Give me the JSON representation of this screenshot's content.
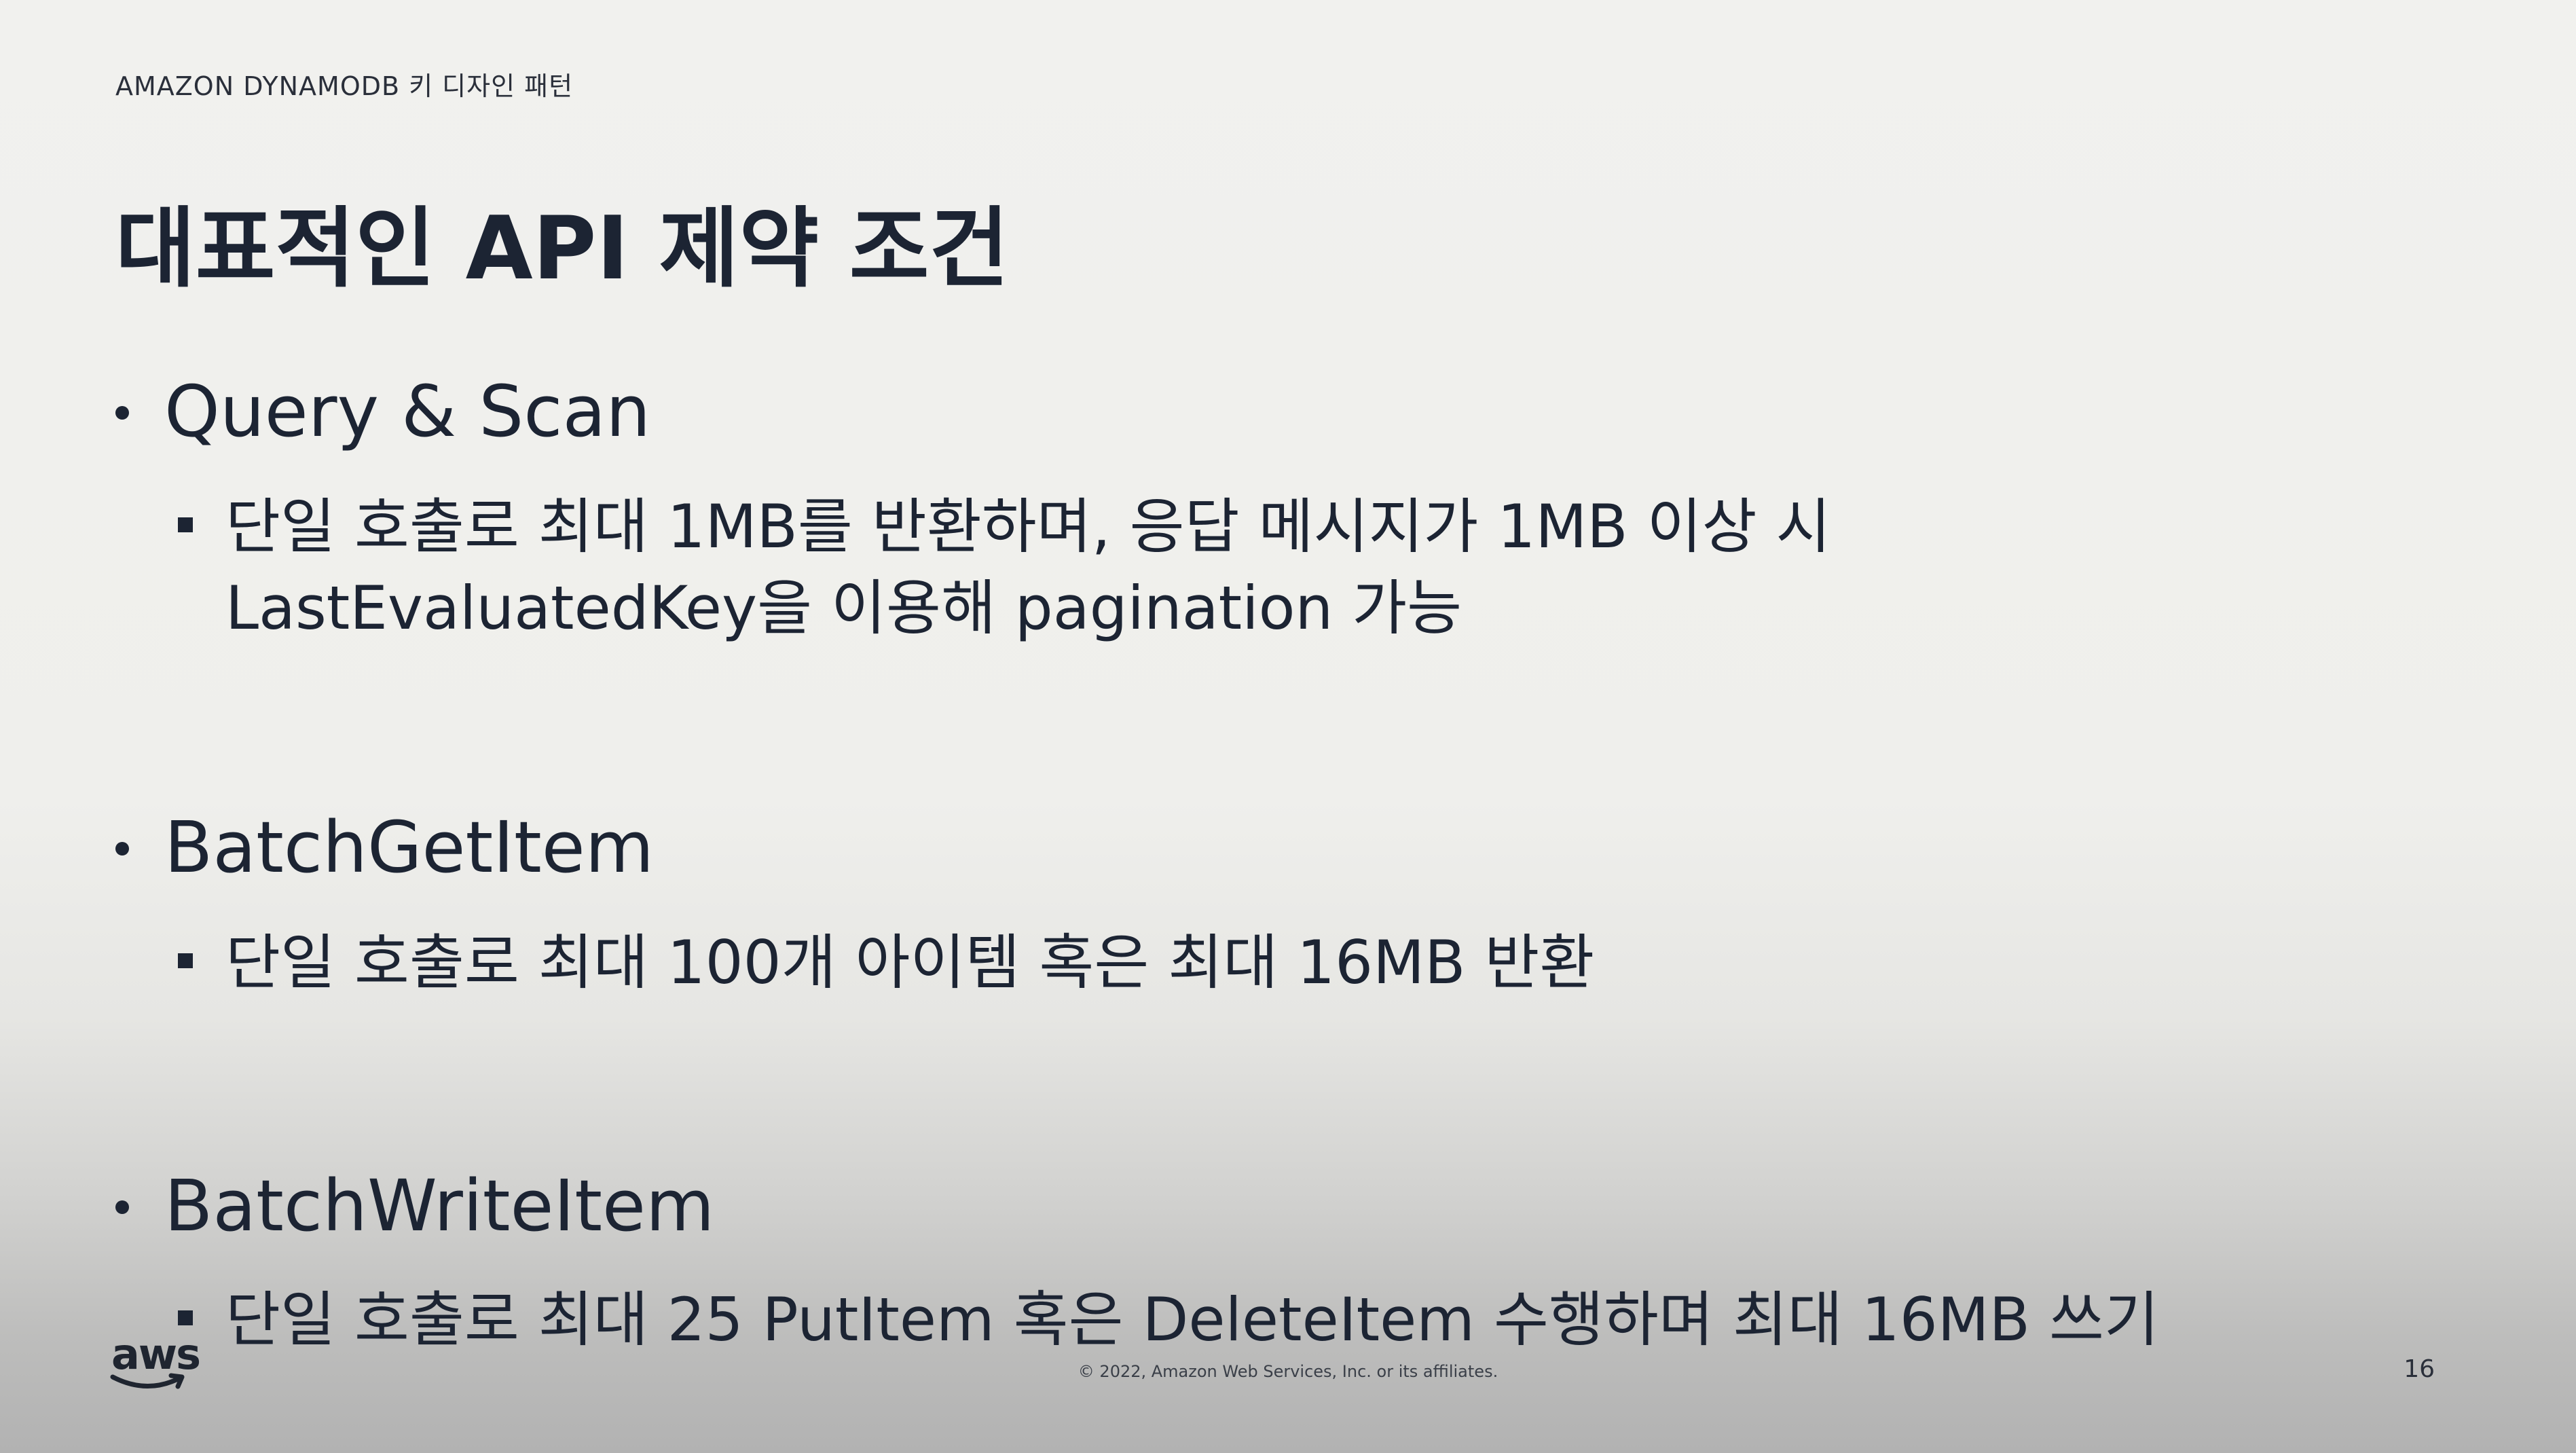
{
  "header": {
    "subtitle": "AMAZON DYNAMODB 키 디자인 패턴",
    "title": "대표적인 API 제약 조건"
  },
  "bullets": [
    {
      "heading": "Query & Scan",
      "subitems": [
        {
          "line1": "단일 호출로 최대 1MB를 반환하며, 응답 메시지가 1MB 이상 시",
          "line2": "LastEvaluatedKey을 이용해 pagination 가능"
        }
      ]
    },
    {
      "heading": "BatchGetItem",
      "subitems": [
        {
          "line1": "단일 호출로 최대 100개 아이템 혹은 최대 16MB 반환"
        }
      ]
    },
    {
      "heading": "BatchWriteItem",
      "subitems": [
        {
          "line1": "단일 호출로 최대 25 PutItem 혹은 DeleteItem 수행하며 최대 16MB 쓰기"
        }
      ]
    }
  ],
  "footer": {
    "logo_text": "aws",
    "copyright": "© 2022, Amazon Web Services, Inc. or its affiliates.",
    "page_number": "16"
  },
  "colors": {
    "text": "#1c2433",
    "smile_arrow": "#1f2530"
  }
}
